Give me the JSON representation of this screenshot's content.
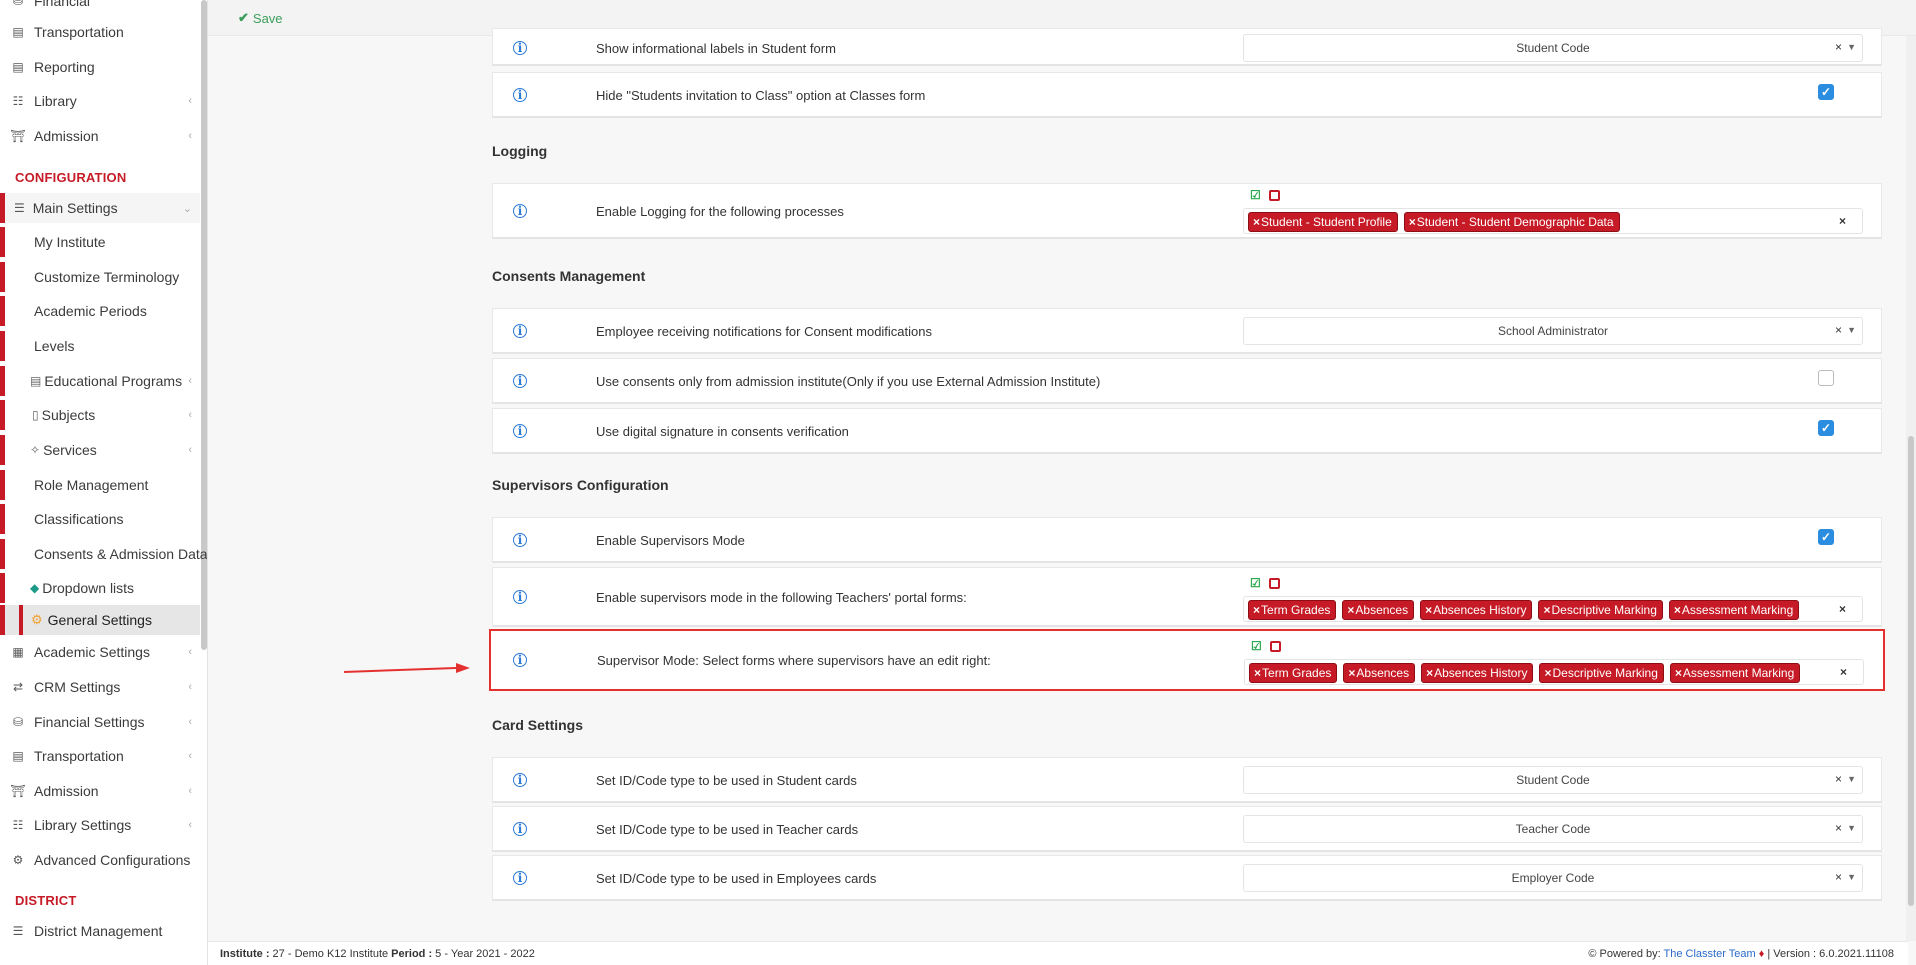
{
  "sidebar": {
    "top_items": [
      {
        "label": "Financial",
        "icon": "coins-icon"
      },
      {
        "label": "Transportation",
        "icon": "bus-icon"
      },
      {
        "label": "Reporting",
        "icon": "printer-icon"
      },
      {
        "label": "Library",
        "icon": "books-icon"
      },
      {
        "label": "Admission",
        "icon": "bank-icon"
      }
    ],
    "configuration_label": "CONFIGURATION",
    "main_settings": {
      "label": "Main Settings",
      "icon": "sliders-icon"
    },
    "sub_items": [
      {
        "label": "My Institute"
      },
      {
        "label": "Customize Terminology"
      },
      {
        "label": "Academic Periods"
      },
      {
        "label": "Levels"
      },
      {
        "label": "Educational Programs",
        "icon": "program-icon"
      },
      {
        "label": "Subjects",
        "icon": "book-icon"
      },
      {
        "label": "Services",
        "icon": "services-icon"
      },
      {
        "label": "Role Management"
      },
      {
        "label": "Classifications"
      },
      {
        "label": "Consents & Admission Data"
      },
      {
        "label": "Dropdown lists",
        "icon": "layers-icon"
      }
    ],
    "active_item": {
      "label": "General Settings",
      "icon": "gear-icon"
    },
    "bottom_items": [
      {
        "label": "Academic Settings",
        "icon": "academic-icon"
      },
      {
        "label": "CRM Settings",
        "icon": "crm-icon"
      },
      {
        "label": "Financial Settings",
        "icon": "coins-icon"
      },
      {
        "label": "Transportation",
        "icon": "bus-icon"
      },
      {
        "label": "Admission",
        "icon": "bank-icon"
      },
      {
        "label": "Library Settings",
        "icon": "books-icon"
      },
      {
        "label": "Advanced Configurations",
        "icon": "gears-icon"
      }
    ],
    "district_label": "DISTRICT",
    "district_item": {
      "label": "District Management",
      "icon": "list-icon"
    }
  },
  "toolbar": {
    "save_label": "Save"
  },
  "rows": {
    "student_labels": {
      "label": "Show informational labels in Student form",
      "value": "Student Code"
    },
    "hide_invitation": {
      "label": "Hide \"Students invitation to Class\" option at Classes form",
      "checked": true
    },
    "logging_title": "Logging",
    "logging": {
      "label": "Enable Logging for the following processes",
      "tags": [
        "Student - Student Profile",
        "Student - Student Demographic Data"
      ]
    },
    "consents_title": "Consents Management",
    "consent_employee": {
      "label": "Employee receiving notifications for Consent modifications",
      "value": "School Administrator"
    },
    "consent_admission": {
      "label": "Use consents only from admission institute(Only if you use External Admission Institute)",
      "checked": false
    },
    "consent_signature": {
      "label": "Use digital signature in consents verification",
      "checked": true
    },
    "supervisors_title": "Supervisors Configuration",
    "supervisors_mode": {
      "label": "Enable Supervisors Mode",
      "checked": true
    },
    "supervisors_forms": {
      "label": "Enable supervisors mode in the following Teachers' portal forms:",
      "tags": [
        "Term Grades",
        "Absences",
        "Absences History",
        "Descriptive Marking",
        "Assessment Marking"
      ]
    },
    "supervisors_edit": {
      "label": "Supervisor Mode: Select forms where supervisors have an edit right:",
      "tags": [
        "Term Grades",
        "Absences",
        "Absences History",
        "Descriptive Marking",
        "Assessment Marking"
      ]
    },
    "card_title": "Card Settings",
    "card_student": {
      "label": "Set ID/Code type to be used in Student cards",
      "value": "Student Code"
    },
    "card_teacher": {
      "label": "Set ID/Code type to be used in Teacher cards",
      "value": "Teacher Code"
    },
    "card_employee": {
      "label": "Set ID/Code type to be used in Employees cards",
      "value": "Employer Code"
    }
  },
  "footer": {
    "institute_label": "Institute :",
    "institute_value": " 27 - Demo K12 Institute ",
    "period_label": "Period :",
    "period_value": " 5 - Year 2021 - 2022",
    "powered_by": "Powered by:",
    "team": "The Classter Team",
    "version": "| Version : 6.0.2021.11108"
  },
  "colors": {
    "accent": "#c61b26",
    "checkbox": "#2a8de0",
    "save": "#3b9e5b",
    "highlight": "#e53030"
  }
}
